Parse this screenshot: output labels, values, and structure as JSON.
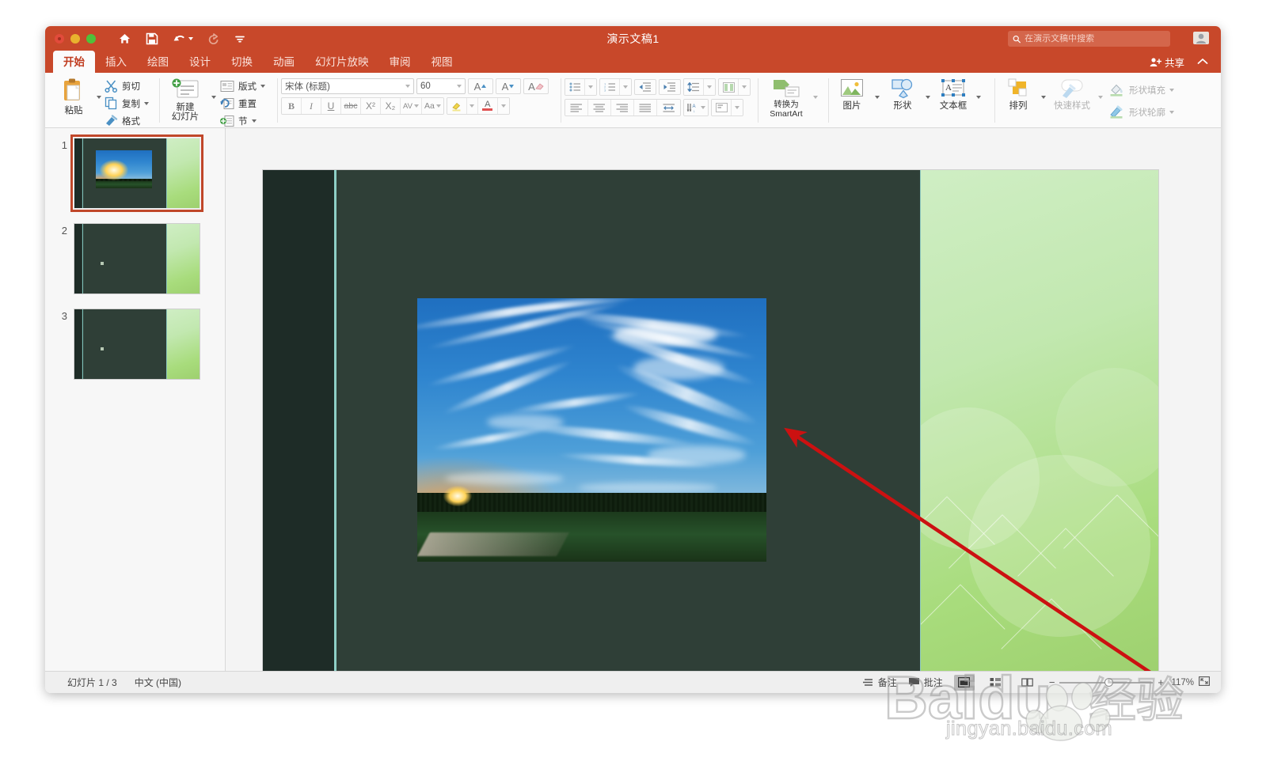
{
  "window": {
    "title": "演示文稿1",
    "traffic_lights": [
      "close",
      "minimize",
      "maximize"
    ]
  },
  "quick_access": [
    {
      "name": "home-icon",
      "label": "主页"
    },
    {
      "name": "save-icon",
      "label": "保存"
    },
    {
      "name": "undo-icon",
      "label": "撤消"
    },
    {
      "name": "redo-icon",
      "label": "恢复"
    },
    {
      "name": "customize-icon",
      "label": "自定义快速访问工具栏"
    }
  ],
  "search": {
    "placeholder": "在演示文稿中搜索",
    "value": "",
    "icon": "search-icon"
  },
  "account_icon": "account-icon",
  "ribbon": {
    "tabs": [
      {
        "label": "开始",
        "active": true
      },
      {
        "label": "插入",
        "active": false
      },
      {
        "label": "绘图",
        "active": false
      },
      {
        "label": "设计",
        "active": false
      },
      {
        "label": "切换",
        "active": false
      },
      {
        "label": "动画",
        "active": false
      },
      {
        "label": "幻灯片放映",
        "active": false
      },
      {
        "label": "审阅",
        "active": false
      },
      {
        "label": "视图",
        "active": false
      }
    ],
    "share_label": "共享",
    "collapse_icon": "chevron-up-icon",
    "groups": {
      "clipboard": {
        "paste_label": "粘贴",
        "cut_label": "剪切",
        "copy_label": "复制",
        "format_label": "格式"
      },
      "slides": {
        "new_slide_line1": "新建",
        "new_slide_line2": "幻灯片",
        "layout_label": "版式",
        "reset_label": "重置",
        "section_label": "节"
      },
      "font": {
        "font_name": "宋体 (标题)",
        "font_size": "60",
        "grow_label": "A",
        "shrink_label": "A",
        "clear_format_label": "A",
        "bold": "B",
        "italic": "I",
        "underline": "U",
        "strikethrough": "abc",
        "superscript": "X²",
        "subscript": "X₂",
        "char_spacing": "AV",
        "change_case": "Aa",
        "highlight": "highlight-icon",
        "font_color": "A"
      },
      "paragraph": {
        "bullets_icon": "bullet-list-icon",
        "numbering_icon": "numbered-list-icon",
        "decrease_indent_icon": "decrease-indent-icon",
        "increase_indent_icon": "increase-indent-icon",
        "line_spacing_icon": "line-spacing-icon",
        "columns_icon": "columns-icon",
        "align_left_icon": "align-left-icon",
        "align_center_icon": "align-center-icon",
        "align_right_icon": "align-right-icon",
        "justify_icon": "justify-icon",
        "text_direction_icon": "text-direction-icon",
        "sort_icon": "sort-icon",
        "align_text_icon": "align-text-icon",
        "smartart_line1": "转换为",
        "smartart_line2": "SmartArt"
      },
      "insert": {
        "picture_label": "图片",
        "shapes_label": "形状",
        "textbox_label": "文本框"
      },
      "drawing": {
        "arrange_label": "排列",
        "quick_styles_label": "快速样式",
        "shape_fill_label": "形状填充",
        "shape_outline_label": "形状轮廓"
      }
    }
  },
  "slides_pane": {
    "slides": [
      {
        "number": "1",
        "selected": true,
        "has_photo": true
      },
      {
        "number": "2",
        "selected": false,
        "has_photo": false
      },
      {
        "number": "3",
        "selected": false,
        "has_photo": false
      }
    ]
  },
  "canvas": {
    "photo_alt": "日落天空与云彩照片",
    "annotation": {
      "type": "arrow",
      "color": "#cc1111",
      "direction": "up-left"
    }
  },
  "status_bar": {
    "slide_counter": "幻灯片 1 / 3",
    "language": "中文 (中国)",
    "notes_label": "备注",
    "comments_label": "批注",
    "views": [
      {
        "name": "normal-view",
        "active": true
      },
      {
        "name": "slide-sorter-view",
        "active": false
      },
      {
        "name": "reading-view",
        "active": false
      }
    ],
    "zoom_level": "117%",
    "zoom_out_label": "−",
    "zoom_in_label": "+",
    "fit_icon": "fit-slide-icon"
  },
  "watermark": {
    "brand": "Baidu 经验",
    "url": "jingyan.baidu.com"
  },
  "colors": {
    "ribbon_accent": "#c8482a",
    "selected_slide_border": "#c0472a",
    "slide_background": "#2f3f37",
    "slide_dark_strip": "#1e2c27",
    "slide_teal_line": "#7fc3bb",
    "annotation_red": "#cc1111"
  }
}
